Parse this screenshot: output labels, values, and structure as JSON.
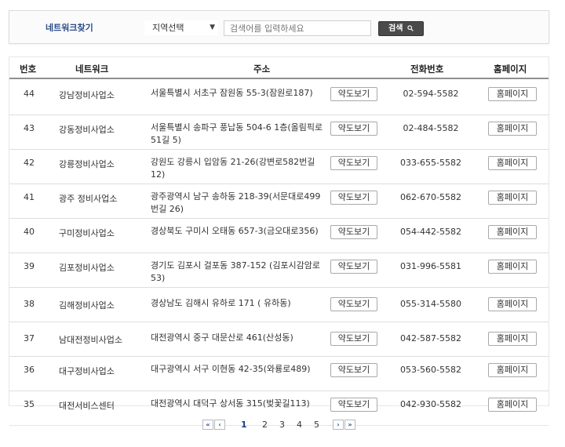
{
  "search": {
    "label": "네트워크찾기",
    "region_select": "지역선택",
    "placeholder": "검색어를 입력하세요",
    "button_label": "검색"
  },
  "table": {
    "headers": {
      "no": "번호",
      "network": "네트워크",
      "address": "주소",
      "phone": "전화번호",
      "homepage": "홈페이지"
    },
    "map_button": "약도보기",
    "home_button": "홈페이지",
    "rows": [
      {
        "no": "44",
        "name": "강남정비사업소",
        "address": "서울특별시  서초구 잠원동 55-3(잠원로187)",
        "phone": "02-594-5582"
      },
      {
        "no": "43",
        "name": "강동정비사업소",
        "address": "서울특별시  송파구 풍납동 504-6 1층(올림픽로51길 5)",
        "phone": "02-484-5582"
      },
      {
        "no": "42",
        "name": "강릉정비사업소",
        "address": "강원도  강릉시 입암동 21-26(강변로582번길 12)",
        "phone": "033-655-5582"
      },
      {
        "no": "41",
        "name": "광주 정비사업소",
        "address": "광주광역시  남구 송하동 218-39(서문대로499번길 26)",
        "phone": "062-670-5582"
      },
      {
        "no": "40",
        "name": "구미정비사업소",
        "address": "경상북도  구미시 오태동 657-3(금오대로356)",
        "phone": "054-442-5582"
      },
      {
        "no": "39",
        "name": "김포정비사업소",
        "address": "경기도  김포시 걸포동 387-152 (김포시감암로 53)",
        "phone": "031-996-5581"
      },
      {
        "no": "38",
        "name": "김해정비사업소",
        "address": "경상남도  김해시 유하로 171 ( 유하동)",
        "phone": "055-314-5580"
      },
      {
        "no": "37",
        "name": "남대전정비사업소",
        "address": "대전광역시  중구 대문산로 461(산성동)",
        "phone": "042-587-5582"
      },
      {
        "no": "36",
        "name": "대구정비사업소",
        "address": "대구광역시  서구 이현동 42-35(와룡로489)",
        "phone": "053-560-5582"
      },
      {
        "no": "35",
        "name": "대전서비스센터",
        "address": "대전광역시  대덕구 상서동 315(벚꽃길113)",
        "phone": "042-930-5582"
      }
    ]
  },
  "pagination": {
    "first": "«",
    "prev": "‹",
    "next": "›",
    "last": "»",
    "pages": [
      "1",
      "2",
      "3",
      "4",
      "5"
    ],
    "current": "1"
  }
}
